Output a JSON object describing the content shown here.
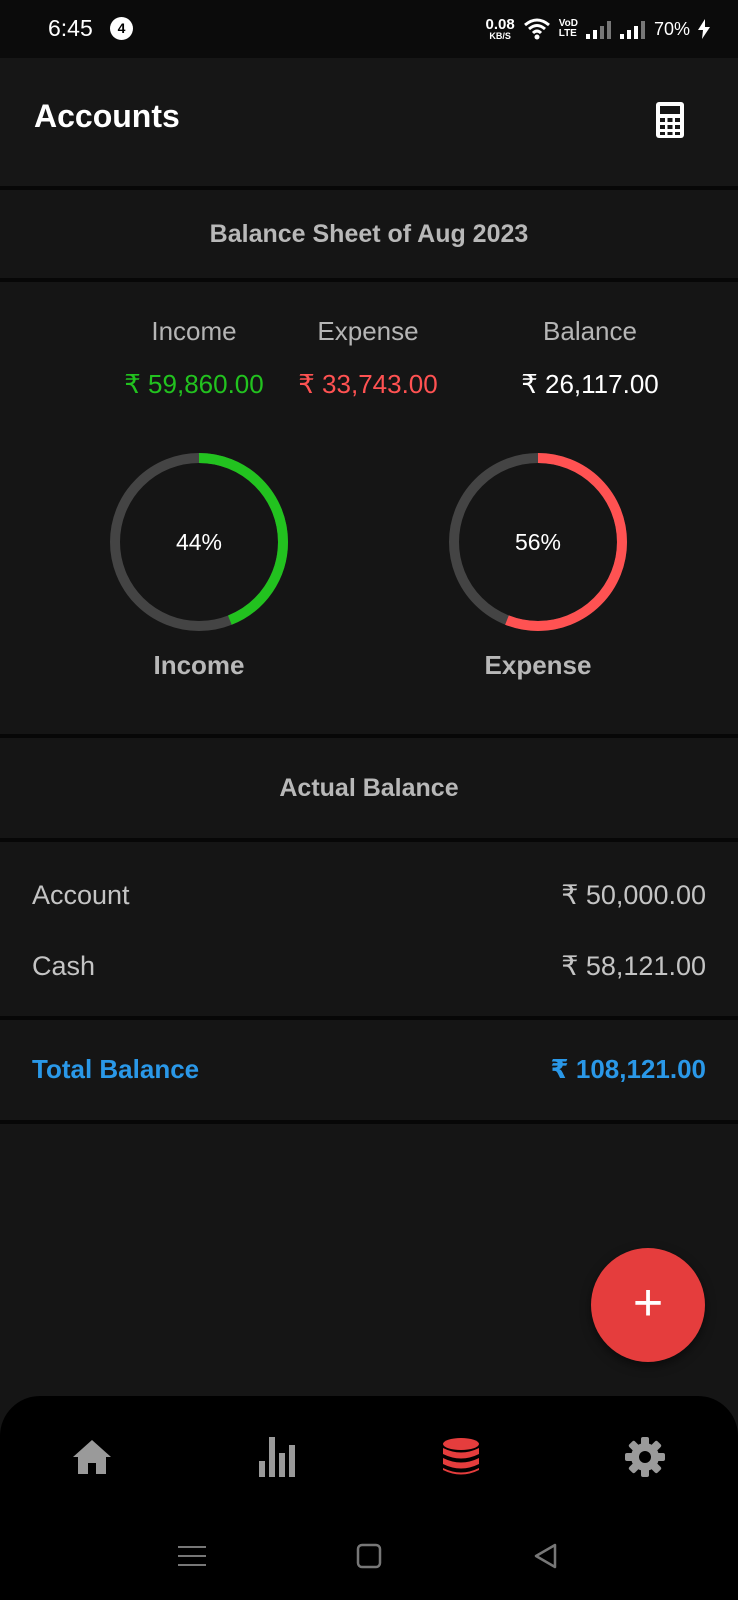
{
  "status_bar": {
    "time": "6:45",
    "notification_count": "4",
    "net_speed_value": "0.08",
    "net_speed_unit": "KB/S",
    "volte_line1": "VoD",
    "volte_line2": "LTE",
    "battery": "70%"
  },
  "header": {
    "title": "Accounts",
    "calculator_icon": "calculator-icon"
  },
  "balance_sheet": {
    "title": "Balance Sheet of Aug 2023",
    "income_label": "Income",
    "income_value": "₹ 59,860.00",
    "expense_label": "Expense",
    "expense_value": "₹ 33,743.00",
    "balance_label": "Balance",
    "balance_value": "₹ 26,117.00",
    "income_ring": {
      "percent_text": "44%",
      "fraction": 0.44,
      "label": "Income",
      "color": "#22c21f"
    },
    "expense_ring": {
      "percent_text": "56%",
      "fraction": 0.56,
      "label": "Expense",
      "color": "#ff5252"
    },
    "ring_track_color": "#444444"
  },
  "actual_balance": {
    "title": "Actual Balance",
    "rows": [
      {
        "name": "Account",
        "amount": "₹ 50,000.00"
      },
      {
        "name": "Cash",
        "amount": "₹ 58,121.00"
      }
    ],
    "total_label": "Total Balance",
    "total_amount": "₹ 108,121.00",
    "total_color": "#2a98e8"
  },
  "fab": {
    "label": "+",
    "color": "#e53d3d"
  },
  "bottom_nav": {
    "items": [
      {
        "icon": "home-icon",
        "active": false
      },
      {
        "icon": "stats-icon",
        "active": false
      },
      {
        "icon": "accounts-icon",
        "active": true
      },
      {
        "icon": "settings-icon",
        "active": false
      }
    ],
    "active_color": "#e53d3d",
    "inactive_color": "#9a9a9a"
  },
  "system_nav": [
    "menu-icon",
    "home-square-icon",
    "back-icon"
  ]
}
